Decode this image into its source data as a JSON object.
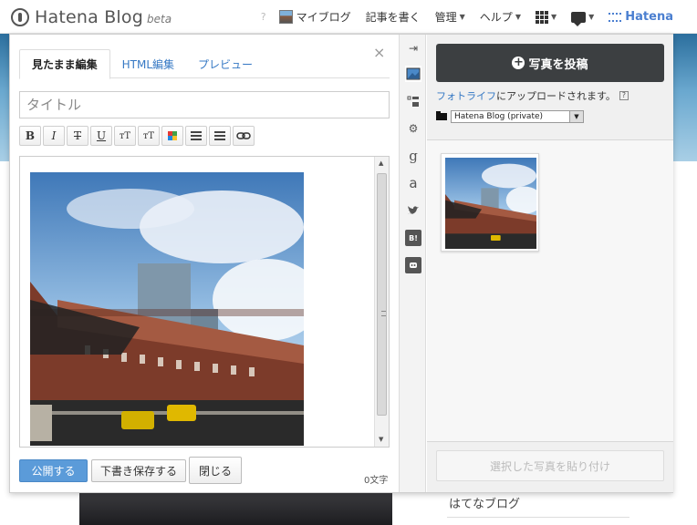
{
  "header": {
    "logo_text": "Hatena Blog",
    "logo_sub": "beta",
    "help_mark": "?",
    "nav": {
      "my_blog": "マイブログ",
      "write": "記事を書く",
      "manage": "管理",
      "help": "ヘルプ",
      "brand": "Hatena"
    }
  },
  "editor": {
    "close_label": "×",
    "tabs": [
      {
        "label": "見たまま編集",
        "active": true
      },
      {
        "label": "HTML編集",
        "active": false
      },
      {
        "label": "プレビュー",
        "active": false
      }
    ],
    "title_placeholder": "タイトル",
    "toolbar": {
      "bold": "B",
      "italic": "I",
      "strike": "T",
      "underline": "U",
      "size_up": "тT",
      "size_down": "тT"
    },
    "buttons": {
      "publish": "公開する",
      "save_draft": "下書き保存する",
      "close": "閉じる"
    },
    "char_count": "0文字"
  },
  "sidebar_icons": {
    "collapse": "⇥",
    "google": "g",
    "amazon": "a",
    "hatena_bookmark": "B!"
  },
  "photo_panel": {
    "upload_button": "写真を投稿",
    "upload_plus": "+",
    "fotolife_link": "フォトライフ",
    "fotolife_suffix": "にアップロードされます。",
    "help_mark": "?",
    "folder_value": "Hatena Blog (private)",
    "paste_button": "選択した写真を貼り付け"
  },
  "background": {
    "side_link": "はてなブログ"
  },
  "colors": {
    "accent_blue": "#3578c4",
    "publish_blue": "#5b9bd9",
    "upload_dark": "#3c3f41",
    "brand_blue": "#4b7fd0"
  }
}
